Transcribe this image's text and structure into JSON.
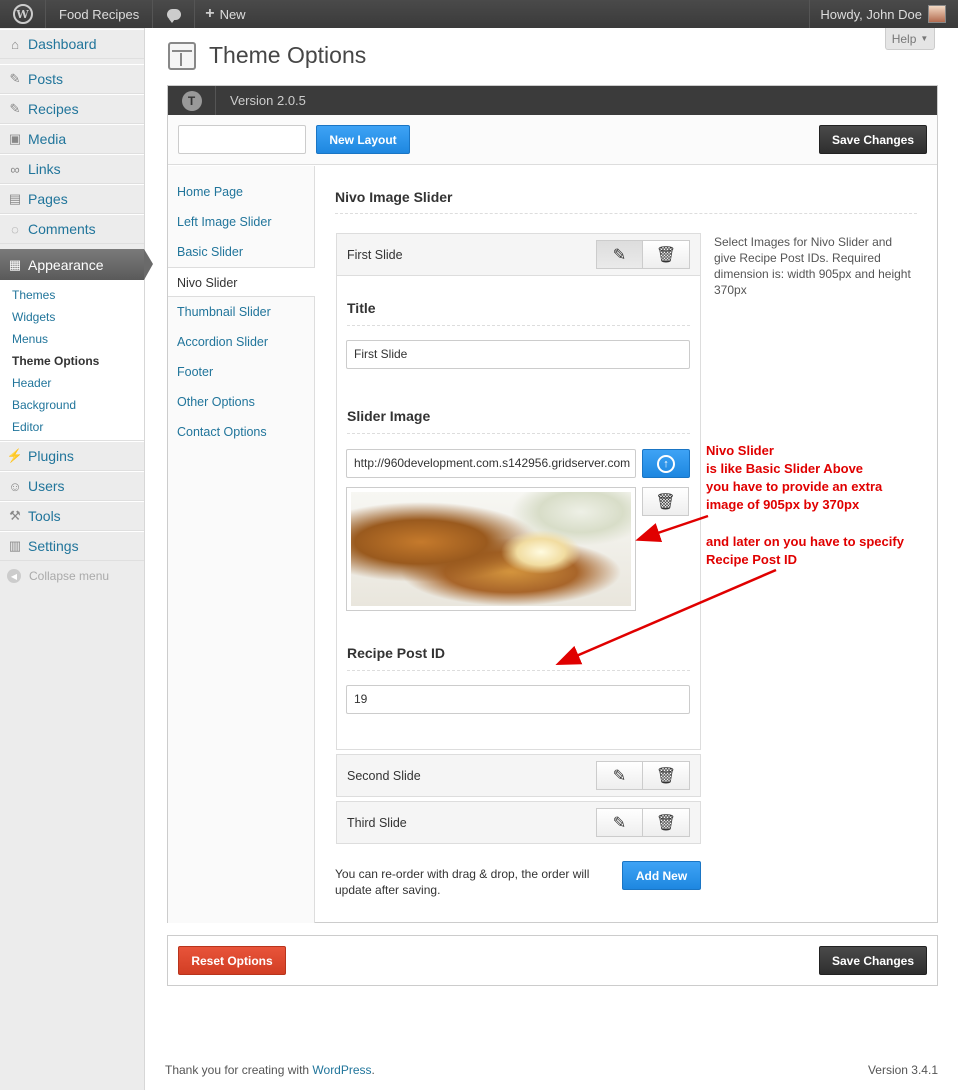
{
  "admin_bar": {
    "site_name": "Food Recipes",
    "new_label": "New",
    "greeting": "Howdy, John Doe"
  },
  "sidebar": {
    "items": [
      {
        "label": "Dashboard",
        "icon": "dashboard-icon"
      },
      {
        "label": "Posts",
        "icon": "pin-icon"
      },
      {
        "label": "Recipes",
        "icon": "pin-icon"
      },
      {
        "label": "Media",
        "icon": "media-icon"
      },
      {
        "label": "Links",
        "icon": "link-icon"
      },
      {
        "label": "Pages",
        "icon": "pages-icon"
      },
      {
        "label": "Comments",
        "icon": "comment-icon"
      },
      {
        "label": "Appearance",
        "icon": "appearance-icon"
      },
      {
        "label": "Plugins",
        "icon": "plugin-icon"
      },
      {
        "label": "Users",
        "icon": "users-icon"
      },
      {
        "label": "Tools",
        "icon": "tools-icon"
      },
      {
        "label": "Settings",
        "icon": "settings-icon"
      }
    ],
    "appearance_submenu": [
      "Themes",
      "Widgets",
      "Menus",
      "Theme Options",
      "Header",
      "Background",
      "Editor"
    ],
    "current_submenu": "Theme Options",
    "collapse_label": "Collapse menu"
  },
  "page": {
    "title": "Theme Options",
    "help_label": "Help"
  },
  "panel": {
    "version": "Version 2.0.5",
    "layout_input_value": "",
    "new_layout_label": "New Layout",
    "save_label": "Save Changes",
    "reset_label": "Reset Options",
    "tabs": [
      "Home Page",
      "Left Image Slider",
      "Basic Slider",
      "Nivo Slider",
      "Thumbnail Slider",
      "Accordion Slider",
      "Footer",
      "Other Options",
      "Contact Options"
    ],
    "active_tab": "Nivo Slider"
  },
  "section": {
    "title": "Nivo Image Slider",
    "description": "Select Images for Nivo Slider and give Recipe Post IDs. Required dimension is: width 905px and height 370px",
    "slides": [
      {
        "name": "First Slide",
        "expanded": true,
        "title_label": "Title",
        "title_value": "First Slide",
        "image_label": "Slider Image",
        "image_url": "http://960development.com.s142956.gridserver.com",
        "post_id_label": "Recipe Post ID",
        "post_id_value": "19"
      },
      {
        "name": "Second Slide",
        "expanded": false
      },
      {
        "name": "Third Slide",
        "expanded": false
      }
    ],
    "reorder_hint": "You can re-order with drag & drop, the order will update after saving.",
    "add_new_label": "Add New"
  },
  "annotations": {
    "note1": [
      "Nivo Slider",
      "is like Basic Slider Above",
      "you have to provide an extra",
      "image of 905px by 370px"
    ],
    "note2": [
      "and later on you have to specify",
      "Recipe Post ID"
    ],
    "color": "#e00000"
  },
  "footer": {
    "thanks_prefix": "Thank you for creating with ",
    "wordpress_link": "WordPress",
    "thanks_suffix": ".",
    "version": "Version 3.4.1"
  },
  "colors": {
    "link": "#21759b",
    "primary_button": "#1e87e0",
    "dark_button": "#333333",
    "danger_button": "#d23e24"
  }
}
